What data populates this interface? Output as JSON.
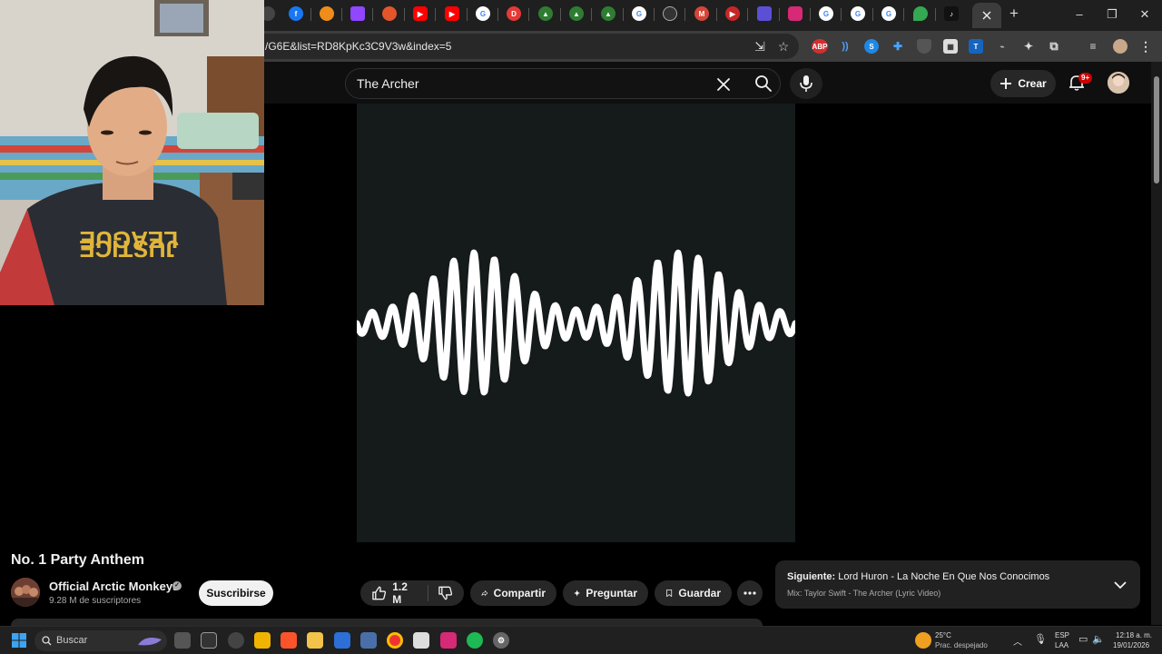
{
  "browser": {
    "url": "/G6E&list=RD8KpKc3C9V3w&index=5",
    "new_tab_label": "+",
    "ext_abp": "ABP",
    "ext_t": "T"
  },
  "youtube": {
    "search_query": "The Archer",
    "create_label": "Crear",
    "notification_badge": "9+"
  },
  "video": {
    "title": "No. 1 Party Anthem",
    "channel_name": "Official Arctic Monkeys",
    "subscribers": "9.28 M de suscriptores",
    "subscribe_label": "Suscribirse",
    "likes": "1.2 M",
    "share_label": "Compartir",
    "ask_label": "Preguntar",
    "save_label": "Guardar"
  },
  "up_next": {
    "prefix": "Siguiente:",
    "title": "Lord Huron - La Noche En Que Nos Conocimos",
    "mix": "Mix: Taylor Swift - The Archer (Lyric Video)"
  },
  "taskbar": {
    "search_label": "Buscar",
    "temperature": "25°C",
    "weather": "Prac. despejado",
    "lang_1": "ESP",
    "lang_2": "LAA",
    "time": "12:18 a. m.",
    "date": "19/01/2026"
  },
  "colors": {
    "youtube_bg": "#0f0f0f",
    "player_bg": "#151a1a",
    "pill_bg": "#272727",
    "subscribe_bg": "#f1f1f1",
    "badge_red": "#cc0000"
  }
}
